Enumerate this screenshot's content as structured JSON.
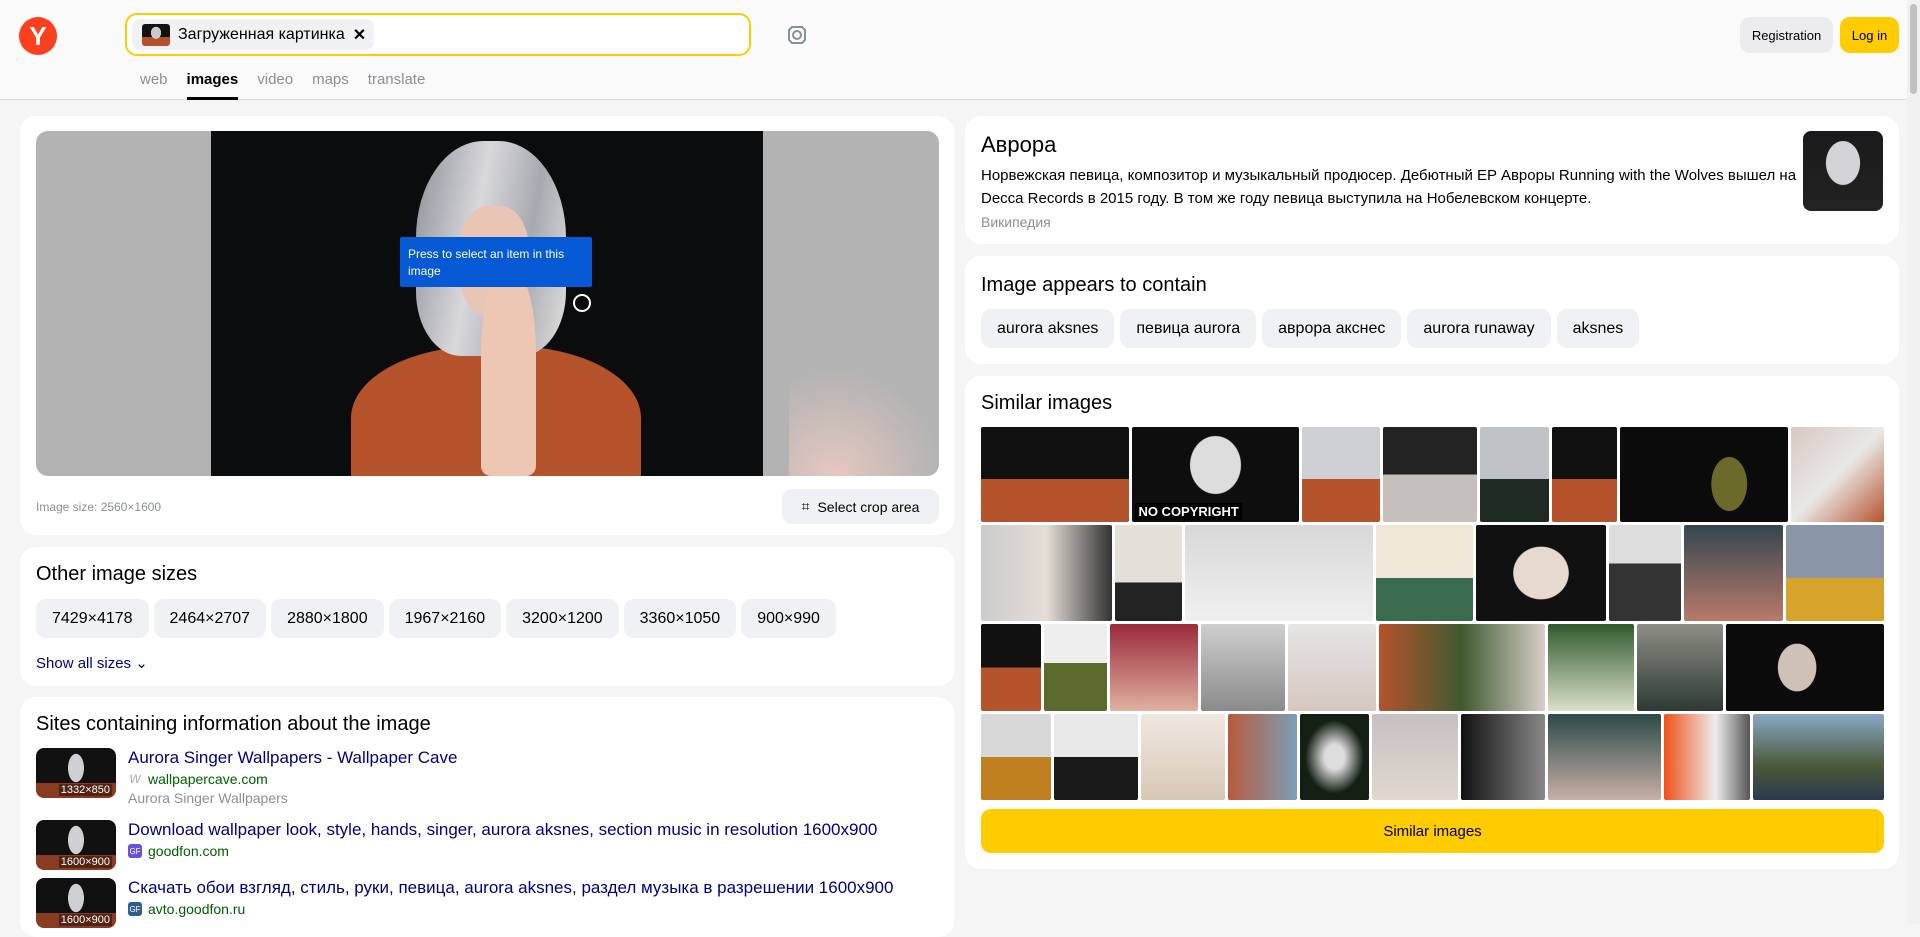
{
  "header": {
    "logo": "Y",
    "search_chip_label": "Загруженная картинка",
    "registration": "Registration",
    "login": "Log in",
    "tabs": [
      "web",
      "images",
      "video",
      "maps",
      "translate"
    ],
    "active_tab": "images"
  },
  "viewer": {
    "tooltip": "Press to select an item in this image",
    "image_size": "Image size: 2560×1600",
    "crop_button": "Select crop area"
  },
  "other_sizes": {
    "title": "Other image sizes",
    "sizes": [
      "7429×4178",
      "2464×2707",
      "2880×1800",
      "1967×2160",
      "3200×1200",
      "3360×1050",
      "900×990"
    ],
    "show_all": "Show all sizes"
  },
  "sites": {
    "title": "Sites containing information about the image",
    "items": [
      {
        "title": "Aurora Singer Wallpapers - Wallpaper Cave",
        "domain": "wallpapercave.com",
        "desc": "Aurora Singer Wallpapers",
        "size": "1332×850",
        "favicon": "W"
      },
      {
        "title": "Download wallpaper look, style, hands, singer, aurora aksnes, section music in resolution 1600x900",
        "domain": "goodfon.com",
        "size": "1600×900",
        "favicon": "GF"
      },
      {
        "title": "Скачать обои взгляд, стиль, руки, певица, aurora aksnes, раздел музыка в разрешении 1600x900",
        "domain": "avto.goodfon.ru",
        "size": "1600×900",
        "favicon": "GF"
      }
    ]
  },
  "entity": {
    "title": "Аврора",
    "text": "Норвежская певица, композитор и музыкальный продюсер. Дебютный EP Авроры Running with the Wolves вышел на Decca Records в 2015 году. В том же году певица выступила на Нобелевском концерте.",
    "source": "Википедия"
  },
  "contains": {
    "title": "Image appears to contain",
    "tags": [
      "aurora aksnes",
      "певица aurora",
      "аврора акснес",
      "aurora runaway",
      "aksnes"
    ]
  },
  "similar": {
    "title": "Similar images",
    "watermark": "NO COPYRIGHT",
    "button": "Similar images"
  },
  "colors": {
    "accent": "#ffcc00",
    "brand": "#fc3f1d",
    "link": "#00007f",
    "tooltip": "#0559d4"
  }
}
